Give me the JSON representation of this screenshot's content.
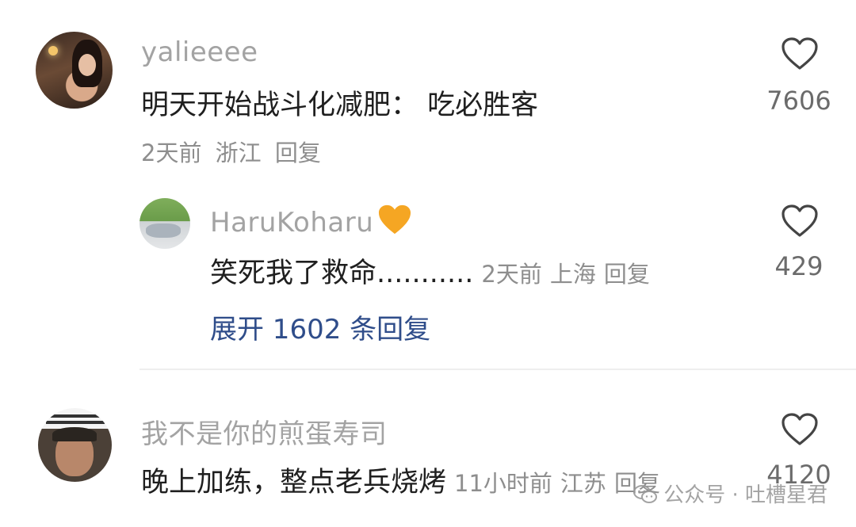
{
  "comments": [
    {
      "username": "yalieeee",
      "text": "明天开始战斗化减肥： 吃必胜客",
      "time": "2天前",
      "location": "浙江",
      "reply": "回复",
      "likes": "7606"
    },
    {
      "username": "我不是你的煎蛋寿司",
      "text": "晚上加练，整点老兵烧烤",
      "time": "11小时前",
      "location": "江苏",
      "reply": "回复",
      "likes": "4120"
    }
  ],
  "reply": {
    "username": "HaruKoharu",
    "username_emoji": "orange-heart",
    "text": "笑死我了救命...........",
    "time": "2天前",
    "location": "上海",
    "reply": "回复",
    "likes": "429"
  },
  "expand_replies": "展开 1602 条回复",
  "watermark": {
    "icon": "wechat-icon",
    "text": "公众号 · 吐槽星君"
  },
  "colors": {
    "username": "#a3a3a3",
    "link": "#2f4d8a",
    "orange_heart": "#f5a623"
  }
}
